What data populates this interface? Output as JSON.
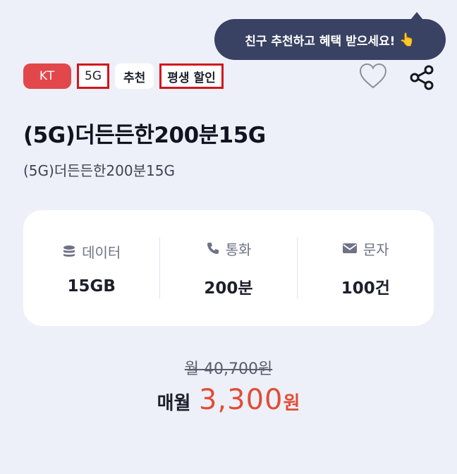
{
  "tooltip": {
    "text": "친구 추천하고 혜택 받으세요!",
    "hand_icon": "pointing-hand-icon"
  },
  "tags": {
    "carrier": "KT",
    "network": "5G",
    "recommend": "추천",
    "discount": "평생 할인"
  },
  "actions": {
    "favorite_icon": "heart-icon",
    "share_icon": "share-icon"
  },
  "plan": {
    "title": "(5G)더든든한200분15G",
    "subtitle": "(5G)더든든한200분15G"
  },
  "specs": [
    {
      "icon": "database-icon",
      "label": "데이터",
      "value": "15GB"
    },
    {
      "icon": "phone-icon",
      "label": "통화",
      "value": "200분"
    },
    {
      "icon": "mail-icon",
      "label": "문자",
      "value": "100건"
    }
  ],
  "pricing": {
    "original": "월 40,700원",
    "monthly_label": "매월",
    "monthly_amount": "3,300",
    "currency": "원"
  },
  "colors": {
    "accent": "#e04e36",
    "carrier": "#e2474b",
    "tooltip_bg": "#3a4263",
    "highlight_border": "#d4141c"
  }
}
